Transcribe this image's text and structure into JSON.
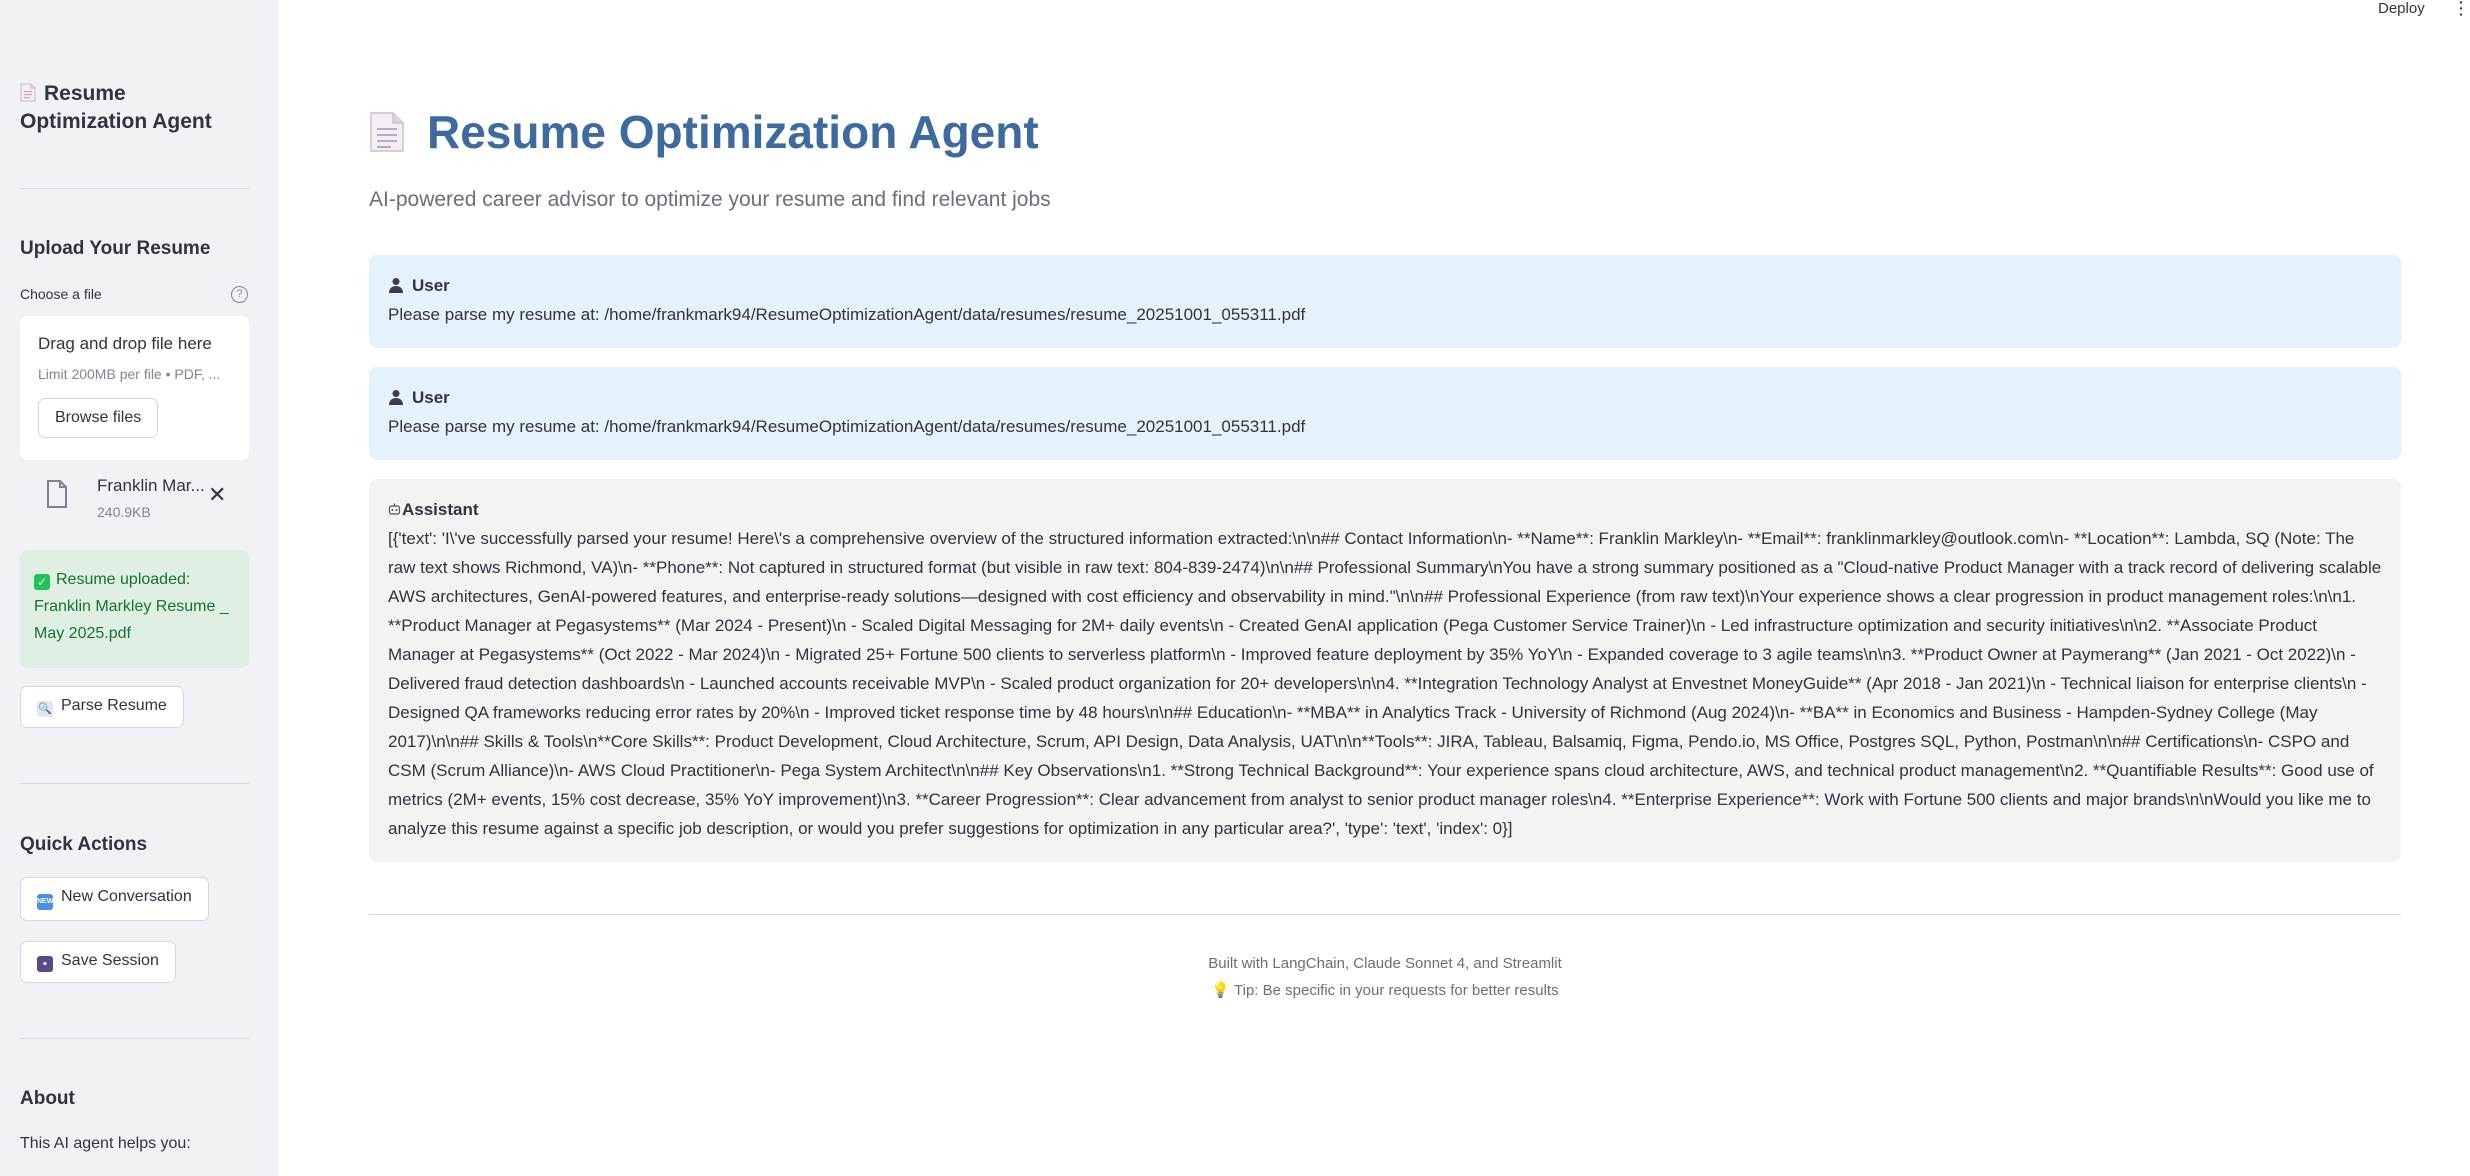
{
  "header": {
    "deploy_label": "Deploy",
    "menu_icon": "kebab-menu-icon"
  },
  "sidebar": {
    "title": "Resume Optimization Agent",
    "upload_heading": "Upload Your Resume",
    "file_label": "Choose a file",
    "dropzone_title": "Drag and drop file here",
    "dropzone_limit": "Limit 200MB per file • PDF, ...",
    "browse_label": "Browse files",
    "uploaded_file": {
      "name": "Franklin Mar...",
      "size": "240.9KB"
    },
    "success_message": "Resume uploaded: Franklin Markley Resume _ May 2025.pdf",
    "parse_button": "Parse Resume",
    "quick_actions_heading": "Quick Actions",
    "new_conversation_button": "New Conversation",
    "save_session_button": "Save Session",
    "about_heading": "About",
    "about_text": "This AI agent helps you:"
  },
  "main": {
    "title": "Resume Optimization Agent",
    "subtitle": "AI-powered career advisor to optimize your resume and find relevant jobs",
    "messages": [
      {
        "role": "User",
        "text": "Please parse my resume at: /home/frankmark94/ResumeOptimizationAgent/data/resumes/resume_20251001_055311.pdf"
      },
      {
        "role": "User",
        "text": "Please parse my resume at: /home/frankmark94/ResumeOptimizationAgent/data/resumes/resume_20251001_055311.pdf"
      },
      {
        "role": "Assistant",
        "text": "[{'text': 'I\\'ve successfully parsed your resume! Here\\'s a comprehensive overview of the structured information extracted:\\n\\n## Contact Information\\n- **Name**: Franklin Markley\\n- **Email**: franklinmarkley@outlook.com\\n- **Location**: Lambda, SQ (Note: The raw text shows Richmond, VA)\\n- **Phone**: Not captured in structured format (but visible in raw text: 804-839-2474)\\n\\n## Professional Summary\\nYou have a strong summary positioned as a \"Cloud-native Product Manager with a track record of delivering scalable AWS architectures, GenAI-powered features, and enterprise-ready solutions—designed with cost efficiency and observability in mind.\"\\n\\n## Professional Experience (from raw text)\\nYour experience shows a clear progression in product management roles:\\n\\n1. **Product Manager at Pegasystems** (Mar 2024 - Present)\\n - Scaled Digital Messaging for 2M+ daily events\\n - Created GenAI application (Pega Customer Service Trainer)\\n - Led infrastructure optimization and security initiatives\\n\\n2. **Associate Product Manager at Pegasystems** (Oct 2022 - Mar 2024)\\n - Migrated 25+ Fortune 500 clients to serverless platform\\n - Improved feature deployment by 35% YoY\\n - Expanded coverage to 3 agile teams\\n\\n3. **Product Owner at Paymerang** (Jan 2021 - Oct 2022)\\n - Delivered fraud detection dashboards\\n - Launched accounts receivable MVP\\n - Scaled product organization for 20+ developers\\n\\n4. **Integration Technology Analyst at Envestnet MoneyGuide** (Apr 2018 - Jan 2021)\\n - Technical liaison for enterprise clients\\n - Designed QA frameworks reducing error rates by 20%\\n - Improved ticket response time by 48 hours\\n\\n## Education\\n- **MBA** in Analytics Track - University of Richmond (Aug 2024)\\n- **BA** in Economics and Business - Hampden-Sydney College (May 2017)\\n\\n## Skills & Tools\\n**Core Skills**: Product Development, Cloud Architecture, Scrum, API Design, Data Analysis, UAT\\n\\n**Tools**: JIRA, Tableau, Balsamiq, Figma, Pendo.io, MS Office, Postgres SQL, Python, Postman\\n\\n## Certifications\\n- CSPO and CSM (Scrum Alliance)\\n- AWS Cloud Practitioner\\n- Pega System Architect\\n\\n## Key Observations\\n1. **Strong Technical Background**: Your experience spans cloud architecture, AWS, and technical product management\\n2. **Quantifiable Results**: Good use of metrics (2M+ events, 15% cost decrease, 35% YoY improvement)\\n3. **Career Progression**: Clear advancement from analyst to senior product manager roles\\n4. **Enterprise Experience**: Work with Fortune 500 clients and major brands\\n\\nWould you like me to analyze this resume against a specific job description, or would you prefer suggestions for optimization in any particular area?', 'type': 'text', 'index': 0}]"
      }
    ]
  },
  "footer": {
    "line1": "Built with LangChain, Claude Sonnet 4, and Streamlit",
    "line2": "Tip: Be specific in your requests for better results"
  },
  "colors": {
    "sidebar_bg": "#f0f2f6",
    "title_blue": "#3d6b9f",
    "user_msg_bg": "#e5f1fb",
    "assistant_msg_bg": "#f3f3f3",
    "success_bg": "#dfefe4",
    "success_text": "#177233"
  }
}
